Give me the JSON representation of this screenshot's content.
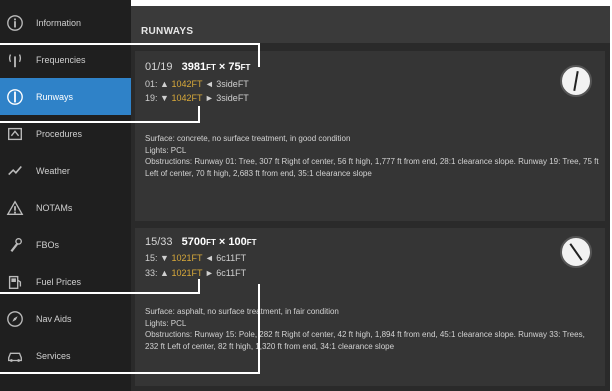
{
  "sidebar": {
    "items": [
      {
        "label": "Information",
        "icon": "info-icon",
        "active": false
      },
      {
        "label": "Frequencies",
        "icon": "radio-tower-icon",
        "active": false
      },
      {
        "label": "Runways",
        "icon": "runway-icon",
        "active": true
      },
      {
        "label": "Procedures",
        "icon": "procedures-icon",
        "active": false
      },
      {
        "label": "Weather",
        "icon": "weather-icon",
        "active": false
      },
      {
        "label": "NOTAMs",
        "icon": "warning-icon",
        "active": false
      },
      {
        "label": "FBOs",
        "icon": "wrench-icon",
        "active": false
      },
      {
        "label": "Fuel Prices",
        "icon": "fuel-icon",
        "active": false
      },
      {
        "label": "Nav Aids",
        "icon": "compass-icon",
        "active": false
      },
      {
        "label": "Services",
        "icon": "car-icon",
        "active": false
      }
    ]
  },
  "header": {
    "title": "RUNWAYS"
  },
  "runways": [
    {
      "ident": "01/19",
      "length": "3981",
      "width": "75",
      "unit": "FT",
      "ends": [
        {
          "end": "01:",
          "arrow": "▲",
          "tora": "1042",
          "tora_unit": "FT",
          "side_arrow": "◄",
          "side": "3side",
          "side_unit": "FT"
        },
        {
          "end": "19:",
          "arrow": "▼",
          "tora": "1042",
          "tora_unit": "FT",
          "side_arrow": "►",
          "side": "3side",
          "side_unit": "FT"
        }
      ],
      "surface": "Surface: concrete, no surface treatment, in good condition",
      "lights": "Lights: PCL",
      "obstructions": "Obstructions: Runway 01: Tree, 307 ft Right of center, 56 ft high, 1,777 ft from end, 28:1 clearance slope. Runway 19: Tree, 75 ft Left of center, 70 ft high, 2,683 ft from end, 35:1 clearance slope"
    },
    {
      "ident": "15/33",
      "length": "5700",
      "width": "100",
      "unit": "FT",
      "ends": [
        {
          "end": "15:",
          "arrow": "▼",
          "tora": "1021",
          "tora_unit": "FT",
          "side_arrow": "◄",
          "side": "6c11",
          "side_unit": "FT"
        },
        {
          "end": "33:",
          "arrow": "▲",
          "tora": "1021",
          "tora_unit": "FT",
          "side_arrow": "►",
          "side": "6c11",
          "side_unit": "FT"
        }
      ],
      "surface": "Surface: asphalt, no surface treatment, in fair condition",
      "lights": "Lights: PCL",
      "obstructions": "Obstructions: Runway 15: Pole, 282 ft Right of center, 42 ft high, 1,894 ft from end, 45:1 clearance slope. Runway 33: Trees, 232 ft Left of center, 82 ft high, 1,320 ft from end, 34:1 clearance slope"
    }
  ]
}
